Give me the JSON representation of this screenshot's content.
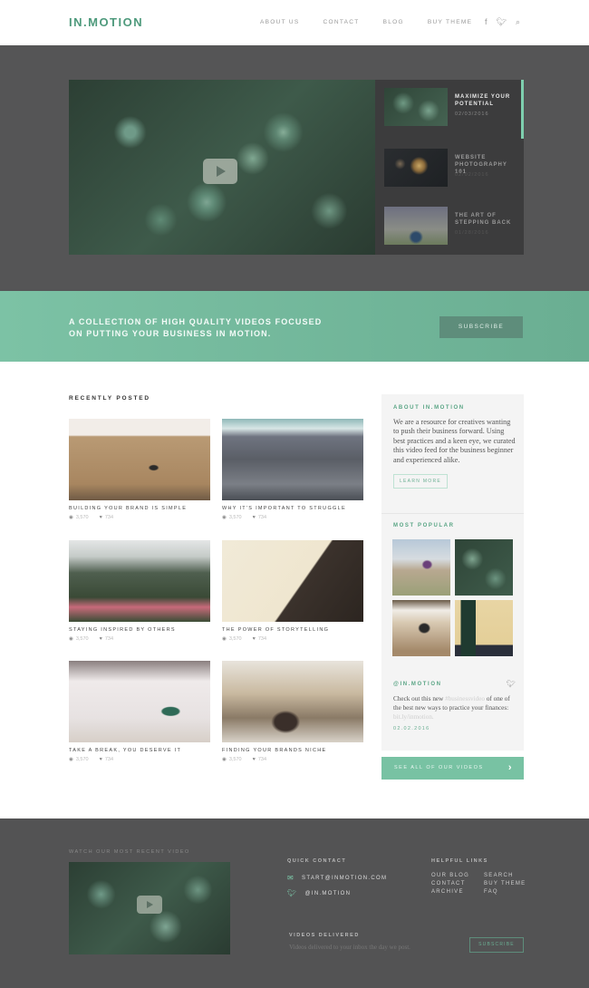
{
  "header": {
    "logo": "IN.MOTION",
    "nav": [
      "About Us",
      "Contact",
      "Blog",
      "Buy Theme"
    ],
    "social_icons": [
      "facebook-icon",
      "twitter-icon",
      "search-icon"
    ]
  },
  "hero": {
    "playlist": [
      {
        "title": "Maximize Your Potential",
        "date": "02/03/2016"
      },
      {
        "title": "Website Photography 101",
        "date": "02/02/2016"
      },
      {
        "title": "The Art of Stepping Back",
        "date": "01/28/2016"
      }
    ]
  },
  "banner": {
    "text_line1": "A collection of high quality videos focused",
    "text_line2": "on putting your business in motion.",
    "subscribe_label": "Subscribe"
  },
  "main": {
    "section_title": "Recently Posted",
    "posts": [
      {
        "title": "Building your brand is simple",
        "views": "3,570",
        "likes": "734"
      },
      {
        "title": "Why it's important to struggle",
        "views": "3,570",
        "likes": "734"
      },
      {
        "title": "Staying inspired by others",
        "views": "3,570",
        "likes": "734"
      },
      {
        "title": "The power of storytelling",
        "views": "3,570",
        "likes": "734"
      },
      {
        "title": "Take a break, you deserve it",
        "views": "3,570",
        "likes": "734"
      },
      {
        "title": "Finding your brands niche",
        "views": "3,570",
        "likes": "734"
      }
    ]
  },
  "sidebar": {
    "about_title": "About In.Motion",
    "about_text": "We are a resource for creatives wanting to push their business forward. Using best practices and a keen eye, we curated this video feed for the business beginner and experienced alike.",
    "learn_more": "Learn More",
    "popular_title": "Most Popular",
    "twitter_handle": "@In.Motion",
    "tweet_pre": "Check out this new ",
    "tweet_tag": "#businessvideo",
    "tweet_mid": " of one of the best new ways to practice your finances: ",
    "tweet_link": "bit.ly/inmotion.",
    "tweet_date": "02.02.2016",
    "see_all": "See all of our videos"
  },
  "footer": {
    "video_label": "Watch our most recent video",
    "quick_contact_title": "Quick Contact",
    "email": "start@inmotion.com",
    "twitter": "@in.motion",
    "helpful_links_title": "Helpful Links",
    "links": [
      "Our Blog",
      "Search",
      "Contact",
      "Buy Theme",
      "Archive",
      "FAQ"
    ],
    "delivered_title": "Videos Delivered",
    "delivered_text": "Videos delivered to your inbox the day we post.",
    "subscribe_label": "Subscribe"
  },
  "colors": {
    "accent": "#6aae92",
    "dark": "#555556",
    "logo": "#4e9a7c"
  }
}
